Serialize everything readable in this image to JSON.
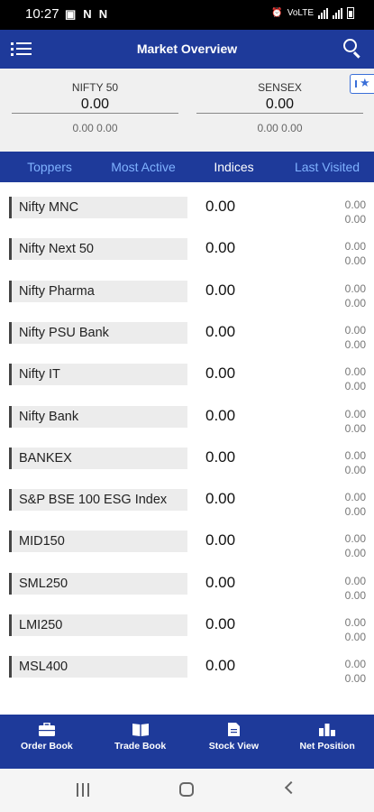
{
  "status_bar": {
    "time": "10:27",
    "left_icons": [
      "image-icon",
      "n-icon",
      "n-icon"
    ],
    "network_text": "VoLTE"
  },
  "header": {
    "title": "Market Overview"
  },
  "indices": [
    {
      "name": "NIFTY 50",
      "value": "0.00",
      "change": "0.00 0.00"
    },
    {
      "name": "SENSEX",
      "value": "0.00",
      "change": "0.00 0.00"
    }
  ],
  "tabs": [
    {
      "label": "Toppers",
      "active": false
    },
    {
      "label": "Most Active",
      "active": false
    },
    {
      "label": "Indices",
      "active": true
    },
    {
      "label": "Last Visited",
      "active": false
    }
  ],
  "rows": [
    {
      "name": "Nifty MNC",
      "value": "0.00",
      "change": "0.00",
      "change_pct": "0.00"
    },
    {
      "name": "Nifty Next 50",
      "value": "0.00",
      "change": "0.00",
      "change_pct": "0.00"
    },
    {
      "name": "Nifty Pharma",
      "value": "0.00",
      "change": "0.00",
      "change_pct": "0.00"
    },
    {
      "name": "Nifty PSU Bank",
      "value": "0.00",
      "change": "0.00",
      "change_pct": "0.00"
    },
    {
      "name": "Nifty IT",
      "value": "0.00",
      "change": "0.00",
      "change_pct": "0.00"
    },
    {
      "name": "Nifty Bank",
      "value": "0.00",
      "change": "0.00",
      "change_pct": "0.00"
    },
    {
      "name": "BANKEX",
      "value": "0.00",
      "change": "0.00",
      "change_pct": "0.00"
    },
    {
      "name": "S&P BSE 100 ESG Index",
      "value": "0.00",
      "change": "0.00",
      "change_pct": "0.00"
    },
    {
      "name": "MID150",
      "value": "0.00",
      "change": "0.00",
      "change_pct": "0.00"
    },
    {
      "name": "SML250",
      "value": "0.00",
      "change": "0.00",
      "change_pct": "0.00"
    },
    {
      "name": "LMI250",
      "value": "0.00",
      "change": "0.00",
      "change_pct": "0.00"
    },
    {
      "name": "MSL400",
      "value": "0.00",
      "change": "0.00",
      "change_pct": "0.00"
    }
  ],
  "bottom_nav": [
    {
      "label": "Order Book",
      "icon": "briefcase-icon"
    },
    {
      "label": "Trade Book",
      "icon": "book-icon"
    },
    {
      "label": "Stock View",
      "icon": "document-icon"
    },
    {
      "label": "Net Position",
      "icon": "bar-chart-icon"
    }
  ],
  "colors": {
    "primary": "#1e3a9a",
    "tab_inactive": "#7fb2ff",
    "tab_active": "#ffffff"
  }
}
